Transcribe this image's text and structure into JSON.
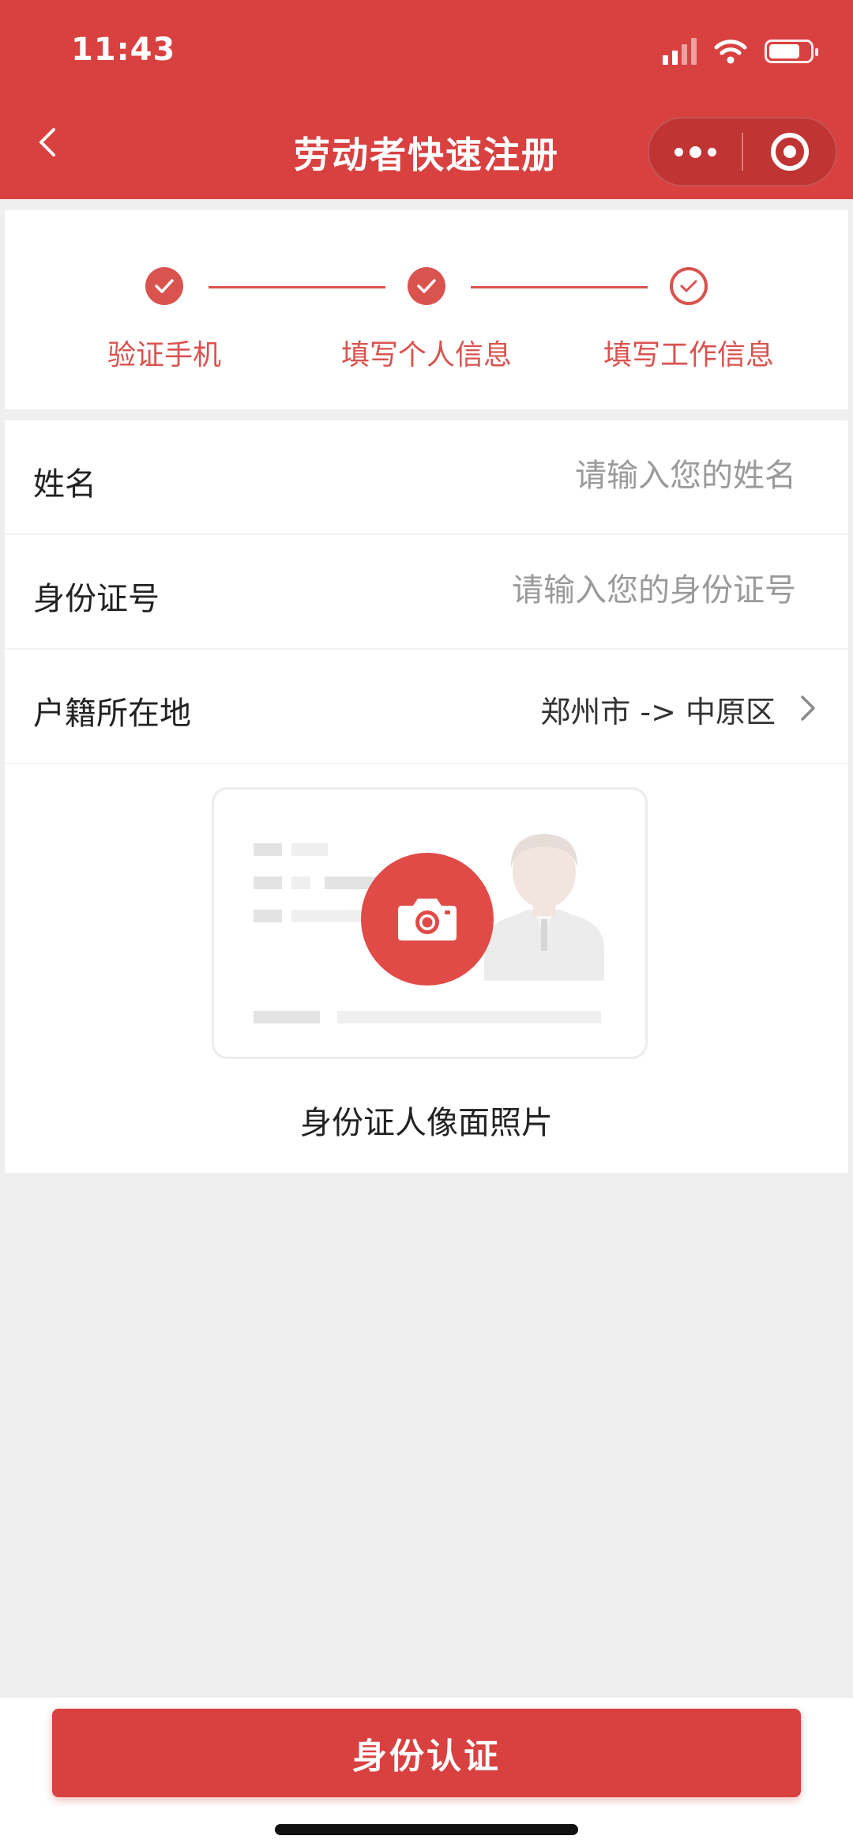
{
  "status_bar": {
    "time": "11:43"
  },
  "header": {
    "title": "劳动者快速注册"
  },
  "steps": [
    {
      "label": "验证手机",
      "state": "done"
    },
    {
      "label": "填写个人信息",
      "state": "done"
    },
    {
      "label": "填写工作信息",
      "state": "current"
    }
  ],
  "form": {
    "name": {
      "label": "姓名",
      "placeholder": "请输入您的姓名",
      "value": ""
    },
    "id_number": {
      "label": "身份证号",
      "placeholder": "请输入您的身份证号",
      "value": ""
    },
    "household": {
      "label": "户籍所在地",
      "value": "郑州市 -> 中原区"
    }
  },
  "id_photo": {
    "caption": "身份证人像面照片",
    "icon": "camera-icon"
  },
  "submit": {
    "label": "身份认证"
  },
  "colors": {
    "accent": "#d94141",
    "background": "#efefef"
  }
}
